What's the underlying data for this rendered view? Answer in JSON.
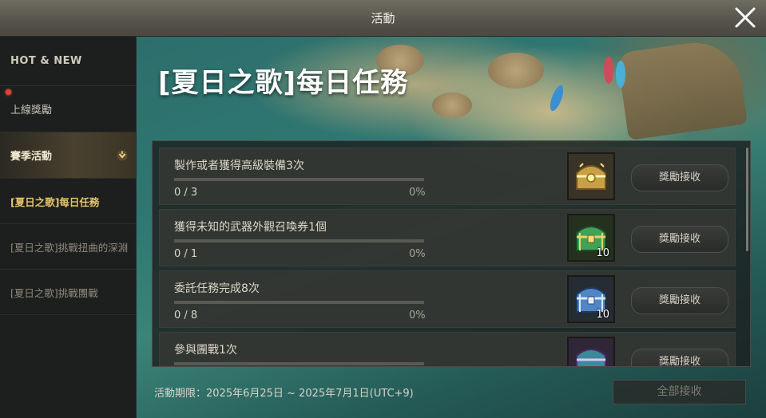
{
  "window": {
    "title": "活動"
  },
  "sidebar": {
    "items": [
      {
        "label": "HOT & NEW"
      },
      {
        "label": "上線獎勵"
      },
      {
        "label": "賽季活動"
      },
      {
        "label": "[夏日之歌]每日任務"
      },
      {
        "label": "[夏日之歌]挑戰扭曲的深淵"
      },
      {
        "label": "[夏日之歌]挑戰團戰"
      }
    ]
  },
  "main": {
    "heading": "[夏日之歌]每日任務",
    "missions": [
      {
        "title": "製作或者獲得高級裝備3次",
        "count": "0 / 3",
        "percent": "0%",
        "progress": 0,
        "reward_icon": "gold-chest-icon",
        "reward_qty": "",
        "button": "獎勵接收"
      },
      {
        "title": "獲得未知的武器外觀召喚券1個",
        "count": "0 / 1",
        "percent": "0%",
        "progress": 0,
        "reward_icon": "green-chest-icon",
        "reward_qty": "10",
        "button": "獎勵接收"
      },
      {
        "title": "委託任務完成8次",
        "count": "0 / 8",
        "percent": "0%",
        "progress": 0,
        "reward_icon": "blue-chest-icon",
        "reward_qty": "10",
        "button": "獎勵接收"
      },
      {
        "title": "參與團戰1次",
        "count": "",
        "percent": "",
        "progress": 0,
        "reward_icon": "purple-chest-icon",
        "reward_qty": "",
        "button": "獎勵接收"
      }
    ],
    "period": "活動期限：2025年6月25日 ~ 2025年7月1日(UTC+9)",
    "claim_all": "全部接收"
  },
  "colors": {
    "accent": "#e7c46a",
    "notification": "#e84030"
  }
}
